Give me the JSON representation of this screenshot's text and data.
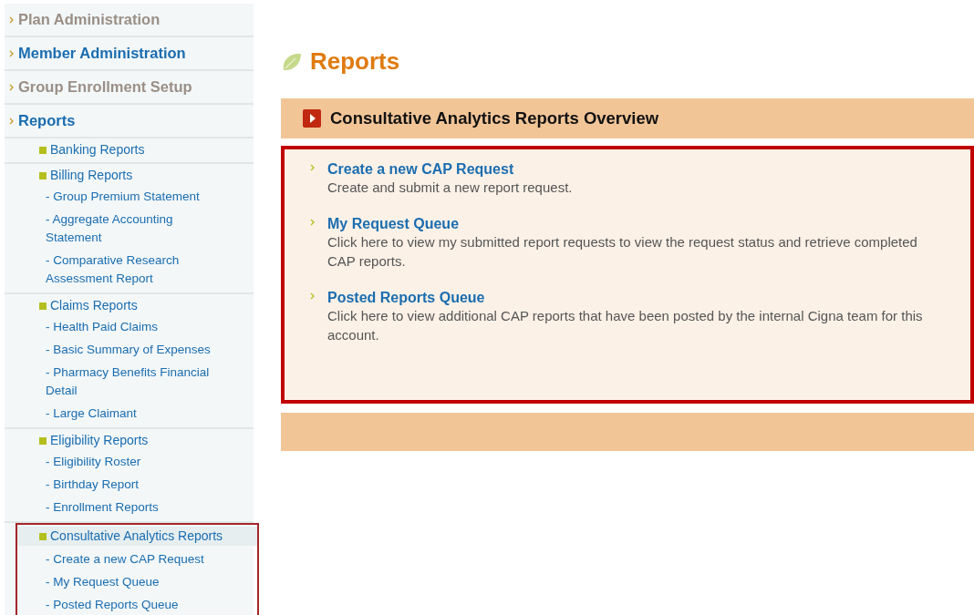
{
  "sidebar": {
    "sections": [
      {
        "label": "Plan Administration",
        "disabled": true
      },
      {
        "label": "Member Administration",
        "disabled": false
      },
      {
        "label": "Group Enrollment Setup",
        "disabled": true
      },
      {
        "label": "Reports",
        "disabled": false,
        "children": [
          {
            "label": "Banking Reports",
            "highlighted": false
          },
          {
            "label": "Billing Reports",
            "highlighted": false,
            "children": [
              {
                "label": "- Group Premium Statement"
              },
              {
                "label": "- Aggregate Accounting Statement"
              },
              {
                "label": "- Comparative Research Assessment Report"
              }
            ]
          },
          {
            "label": "Claims Reports",
            "highlighted": false,
            "children": [
              {
                "label": "- Health Paid Claims"
              },
              {
                "label": "- Basic Summary of Expenses"
              },
              {
                "label": "- Pharmacy Benefits Financial Detail"
              },
              {
                "label": "- Large Claimant"
              }
            ]
          },
          {
            "label": "Eligibility Reports",
            "highlighted": false,
            "children": [
              {
                "label": "- Eligibility Roster"
              },
              {
                "label": "- Birthday Report"
              },
              {
                "label": "- Enrollment Reports"
              }
            ]
          },
          {
            "label": "Consultative Analytics Reports",
            "highlighted": true,
            "children": [
              {
                "label": "- Create a new CAP Request"
              },
              {
                "label": "- My Request Queue"
              },
              {
                "label": "- Posted Reports Queue"
              }
            ]
          }
        ]
      }
    ]
  },
  "page_title": "Reports",
  "panel": {
    "title": "Consultative Analytics Reports Overview",
    "highlighted": true,
    "links": [
      {
        "label": "Create a new CAP Request",
        "description": "Create and submit a new report request."
      },
      {
        "label": "My Request Queue",
        "description": "Click here to view my submitted report requests to view the request status and retrieve completed CAP reports."
      },
      {
        "label": "Posted Reports Queue",
        "description": "Click here to view additional CAP reports that have been posted by the internal Cigna team for this account."
      }
    ]
  }
}
